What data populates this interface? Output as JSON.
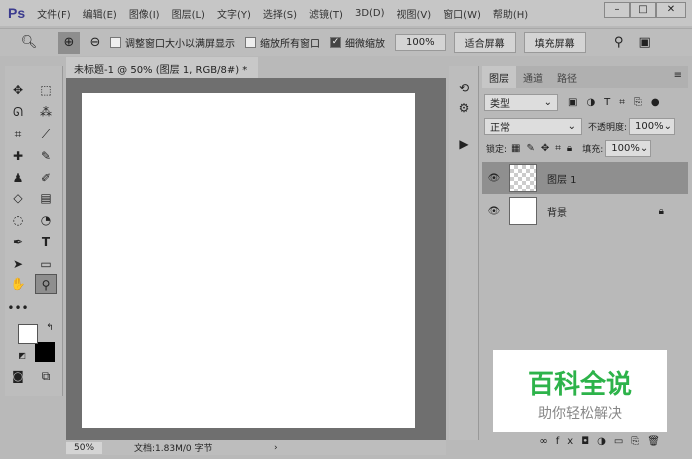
{
  "app": {
    "logo": "Ps",
    "menus": [
      "文件(F)",
      "编辑(E)",
      "图像(I)",
      "图层(L)",
      "文字(Y)",
      "选择(S)",
      "滤镜(T)",
      "3D(D)",
      "视图(V)",
      "窗口(W)",
      "帮助(H)"
    ],
    "window_buttons": [
      "–",
      "□",
      "✕"
    ]
  },
  "options": {
    "resize_windows": "调整窗口大小以满屏显示",
    "zoom_all": "缩放所有窗口",
    "scrubby_zoom": "细微缩放",
    "zoom_value": "100%",
    "fit_screen": "适合屏幕",
    "fill_screen": "填充屏幕"
  },
  "document": {
    "tab_title": "未标题-1 @ 50% (图层 1, RGB/8#) *",
    "close": "×",
    "zoom": "50%",
    "doc_info": "文档:1.83M/0 字节",
    "arrow": "›"
  },
  "layers_panel": {
    "tabs": [
      "图层",
      "通道",
      "路径"
    ],
    "filter_kind": "类型",
    "blend_mode": "正常",
    "opacity_label": "不透明度:",
    "opacity": "100%",
    "lock_label": "锁定:",
    "fill_label": "填充:",
    "fill": "100%",
    "layers": [
      {
        "name": "图层 1",
        "selected": true
      },
      {
        "name": "背景",
        "locked": true
      }
    ]
  },
  "watermark": {
    "title": "百科全说",
    "subtitle": "助你轻松解决"
  }
}
